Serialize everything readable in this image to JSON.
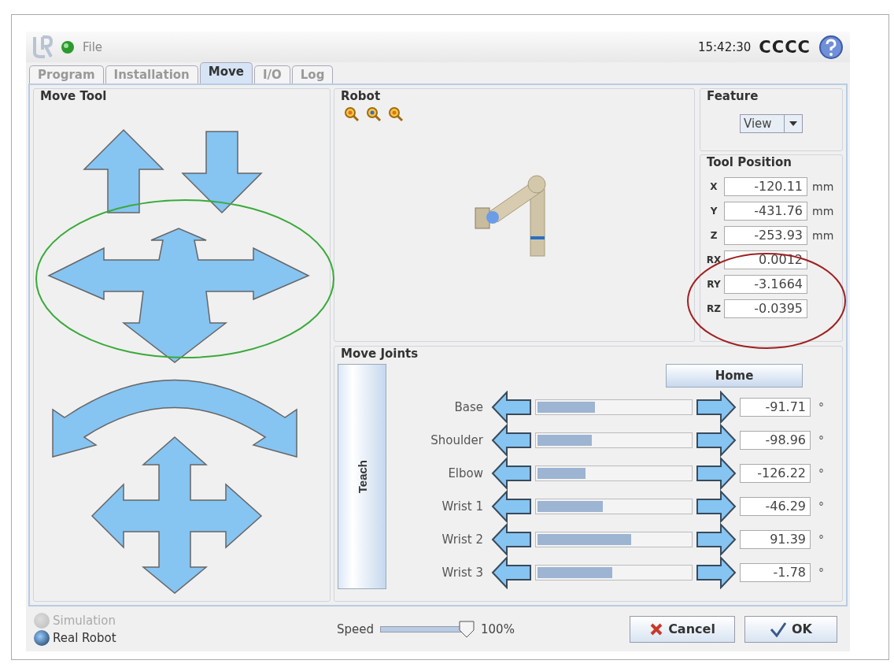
{
  "header": {
    "menu": "File",
    "time": "15:42:30",
    "robot_name": "CCCC"
  },
  "tabs": [
    {
      "label": "Program",
      "selected": false
    },
    {
      "label": "Installation",
      "selected": false
    },
    {
      "label": "Move",
      "selected": true
    },
    {
      "label": "I/O",
      "selected": false
    },
    {
      "label": "Log",
      "selected": false
    }
  ],
  "move_tool": {
    "title": "Move Tool"
  },
  "robot": {
    "title": "Robot"
  },
  "feature": {
    "title": "Feature",
    "value": "View"
  },
  "tool_position": {
    "title": "Tool Position",
    "rows": [
      {
        "label": "X",
        "value": "-120.11",
        "unit": "mm"
      },
      {
        "label": "Y",
        "value": "-431.76",
        "unit": "mm"
      },
      {
        "label": "Z",
        "value": "-253.93",
        "unit": "mm"
      },
      {
        "label": "RX",
        "value": "0.0012"
      },
      {
        "label": "RY",
        "value": "-3.1664"
      },
      {
        "label": "RZ",
        "value": "-0.0395"
      }
    ]
  },
  "move_joints": {
    "title": "Move Joints",
    "teach": "Teach",
    "home": "Home",
    "joints": [
      {
        "name": "Base",
        "level": 0.39,
        "value": "-91.71",
        "unit": "°"
      },
      {
        "name": "Shoulder",
        "level": 0.37,
        "value": "-98.96",
        "unit": "°"
      },
      {
        "name": "Elbow",
        "level": 0.33,
        "value": "-126.22",
        "unit": "°"
      },
      {
        "name": "Wrist 1",
        "level": 0.44,
        "value": "-46.29",
        "unit": "°"
      },
      {
        "name": "Wrist 2",
        "level": 0.62,
        "value": "91.39",
        "unit": "°"
      },
      {
        "name": "Wrist 3",
        "level": 0.5,
        "value": "-1.78",
        "unit": "°"
      }
    ]
  },
  "mode": [
    {
      "label": "Simulation",
      "selected": false,
      "disabled": true
    },
    {
      "label": "Real Robot",
      "selected": true,
      "disabled": false
    }
  ],
  "speed": {
    "label": "Speed",
    "level": 1.0,
    "reading": "100%"
  },
  "buttons": [
    {
      "kind": "cancel",
      "label": "Cancel"
    },
    {
      "kind": "ok",
      "label": "OK"
    }
  ]
}
